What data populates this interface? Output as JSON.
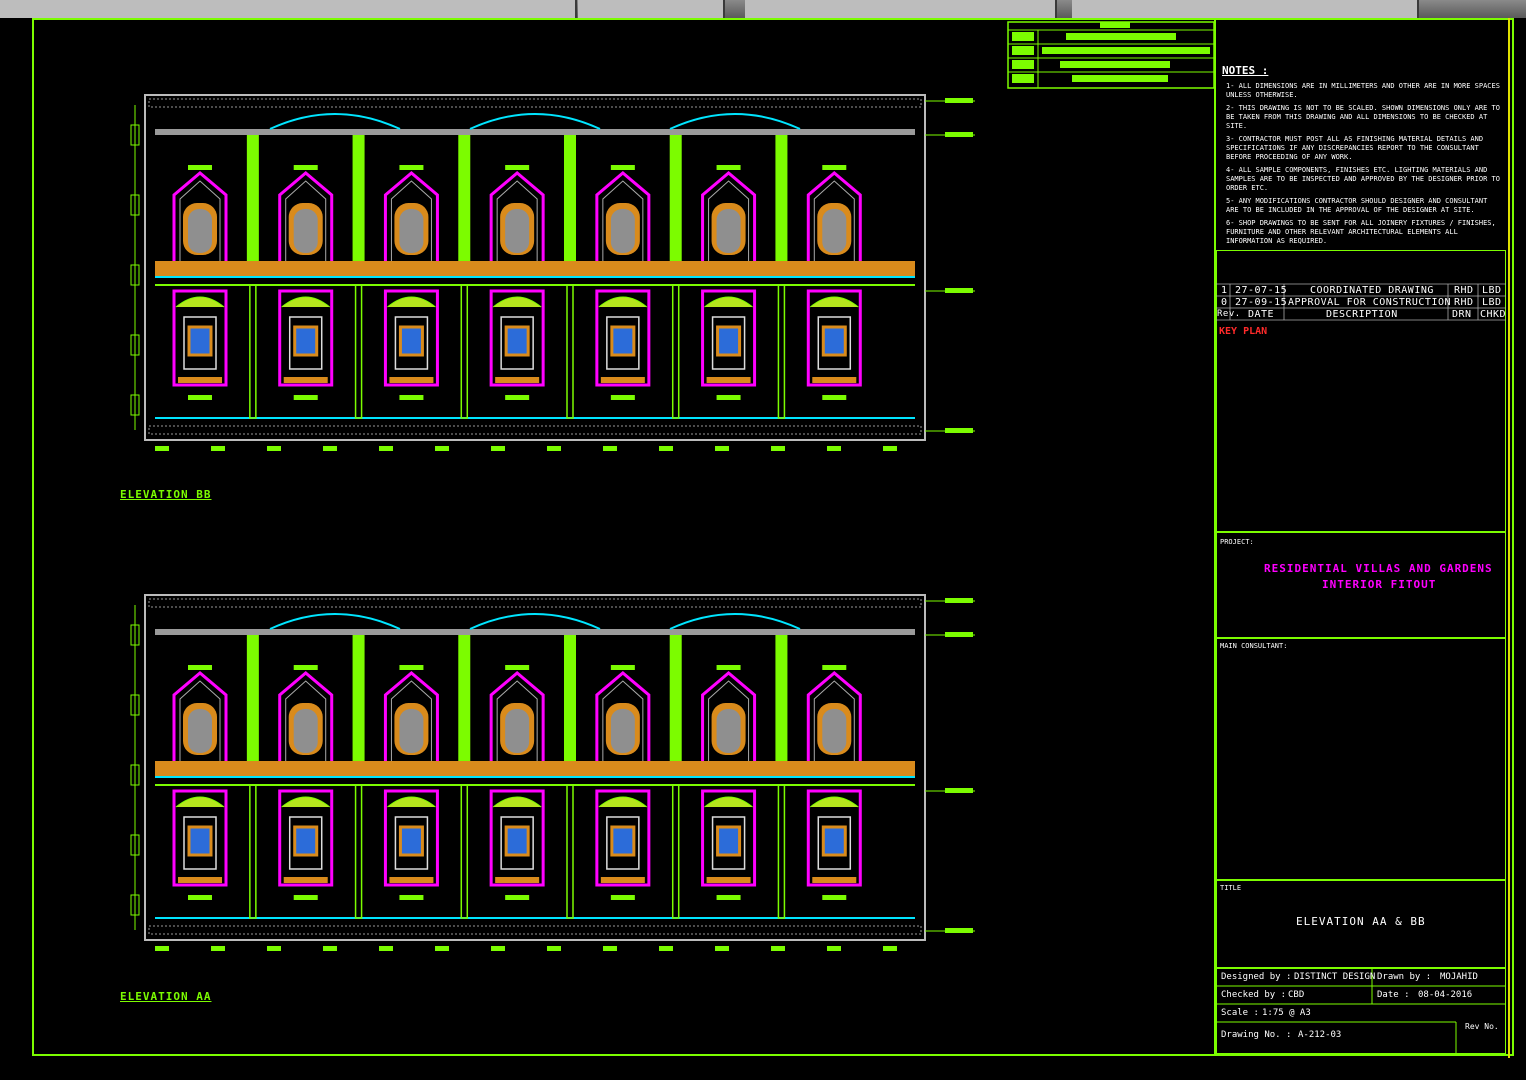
{
  "window": {
    "background": "#000000",
    "accent_green": "#7cfc00",
    "accent_magenta": "#ff00ff",
    "accent_cyan": "#00e5ff",
    "accent_orange": "#d98b1c"
  },
  "drawings": {
    "elevations": [
      {
        "label": "ELEVATION BB",
        "bays": 7
      },
      {
        "label": "ELEVATION AA",
        "bays": 7
      }
    ]
  },
  "title_block": {
    "notes_title": "NOTES :",
    "notes": [
      "1- ALL DIMENSIONS ARE IN MILLIMETERS AND OTHER ARE IN MORE SPACES UNLESS OTHERWISE.",
      "2- THIS DRAWING IS NOT TO BE SCALED. SHOWN DIMENSIONS ONLY ARE TO BE TAKEN FROM THIS DRAWING AND ALL DIMENSIONS TO BE CHECKED AT SITE.",
      "3- CONTRACTOR MUST POST ALL AS FINISHING MATERIAL DETAILS AND SPECIFICATIONS IF ANY DISCREPANCIES REPORT TO THE CONSULTANT BEFORE PROCEEDING OF ANY WORK.",
      "4- ALL SAMPLE COMPONENTS, FINISHES ETC. LIGHTING MATERIALS AND SAMPLES ARE TO BE INSPECTED AND APPROVED BY THE DESIGNER PRIOR TO ORDER ETC.",
      "5- ANY MODIFICATIONS CONTRACTOR SHOULD DESIGNER AND CONSULTANT ARE TO BE INCLUDED IN THE APPROVAL OF THE DESIGNER AT SITE.",
      "6- SHOP DRAWINGS TO BE SENT FOR ALL JOINERY FIXTURES / FINISHES, FURNITURE AND OTHER RELEVANT ARCHITECTURAL ELEMENTS ALL INFORMATION AS REQUIRED."
    ],
    "revisions": [
      {
        "rev": "1",
        "date": "27-07-15",
        "description": "COORDINATED DRAWING",
        "drn": "RHD",
        "chk": "LBD"
      },
      {
        "rev": "0",
        "date": "27-09-15",
        "description": "APPROVAL FOR CONSTRUCTION",
        "drn": "RHD",
        "chk": "LBD"
      }
    ],
    "revision_headers": {
      "rev": "Rev.",
      "date": "DATE",
      "description": "DESCRIPTION",
      "drn": "DRN",
      "chk": "CHKD"
    },
    "key_plan": "KEY PLAN",
    "project_label": "PROJECT:",
    "project_line1": "RESIDENTIAL VILLAS AND GARDENS",
    "project_line2": "INTERIOR FITOUT",
    "consultant_label": "MAIN CONSULTANT:",
    "title_label": "TITLE",
    "title": "ELEVATION AA & BB",
    "designed_by_label": "Designed by :",
    "designed_by": "DISTINCT DESIGN",
    "drawn_by_label": "Drawn by :",
    "drawn_by": "MOJAHID",
    "checked_by_label": "Checked by :",
    "checked_by": "CBD",
    "date_label": "Date :",
    "date": "08-04-2016",
    "scale_label": "Scale :",
    "scale": "1:75 @ A3",
    "drawing_no_label": "Drawing No. :",
    "drawing_no": "A-212-03",
    "rev_label": "Rev No."
  }
}
